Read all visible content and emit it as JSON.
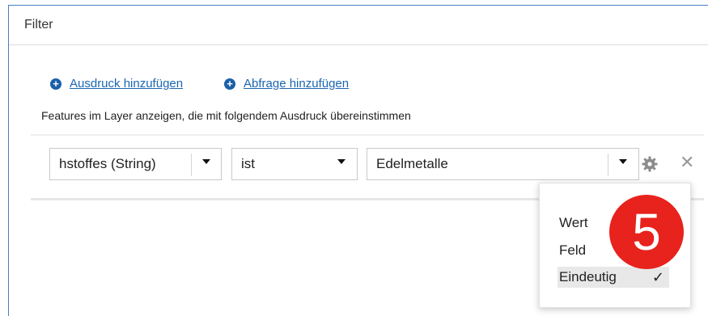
{
  "panel": {
    "title": "Filter"
  },
  "actions": {
    "add_expression": "Ausdruck hinzufügen",
    "add_query": "Abfrage hinzufügen"
  },
  "description": "Features im Layer anzeigen, die mit folgendem Ausdruck übereinstimmen",
  "expression": {
    "field": "hstoffes (String)",
    "operator": "ist",
    "value": "Edelmetalle"
  },
  "value_source_menu": {
    "items": [
      "Wert",
      "Feld",
      "Eindeutig"
    ],
    "selected": "Eindeutig",
    "check_mark": "✓"
  },
  "callout": {
    "number": "5",
    "color": "#e8221c"
  },
  "colors": {
    "link": "#1b66b0",
    "panel_border": "#4a7cc7"
  },
  "icons": [
    "plus-circle-icon",
    "chevron-down-icon",
    "gear-icon",
    "close-icon",
    "checkmark-icon"
  ]
}
